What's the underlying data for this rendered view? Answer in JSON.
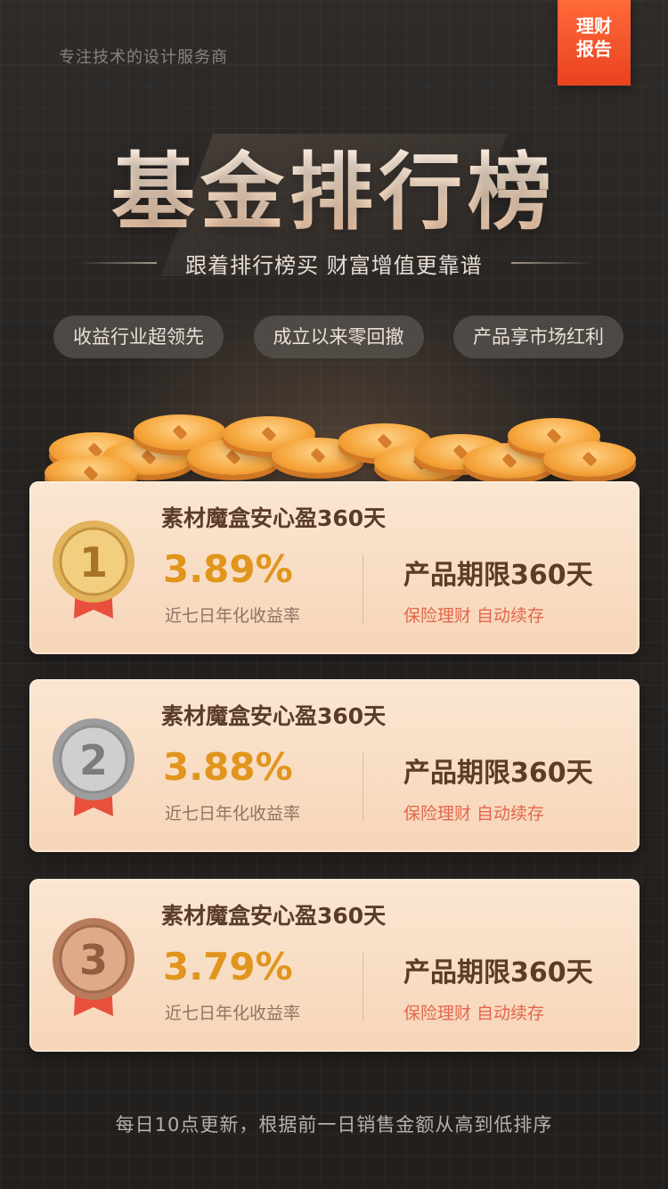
{
  "header": {
    "tagline": "专注技术的设计服务商",
    "ribbon": [
      "理财",
      "报告"
    ],
    "title": "基金排行榜",
    "subtitle": "跟着排行榜买 财富增值更靠谱"
  },
  "pills": [
    "收益行业超领先",
    "成立以来零回撤",
    "产品享市场红利"
  ],
  "cards": [
    {
      "rank": "1",
      "medal": "gold-medal-icon",
      "name": "素材魔盒安心盈360天",
      "rate": "3.89%",
      "rate_label": "近七日年化收益率",
      "term": "产品期限360天",
      "tags": "保险理财 自动续存"
    },
    {
      "rank": "2",
      "medal": "silver-medal-icon",
      "name": "素材魔盒安心盈360天",
      "rate": "3.88%",
      "rate_label": "近七日年化收益率",
      "term": "产品期限360天",
      "tags": "保险理财 自动续存"
    },
    {
      "rank": "3",
      "medal": "bronze-medal-icon",
      "name": "素材魔盒安心盈360天",
      "rate": "3.79%",
      "rate_label": "近七日年化收益率",
      "term": "产品期限360天",
      "tags": "保险理财 自动续存"
    }
  ],
  "footer": "每日10点更新，根据前一日销售金额从高到低排序",
  "colors": {
    "rate": "#e0951c",
    "tags": "#e4674b",
    "ribbon": "#e9421f",
    "gold": "#d7a74a",
    "silver": "#b9b9b9",
    "bronze": "#c88a6a"
  }
}
